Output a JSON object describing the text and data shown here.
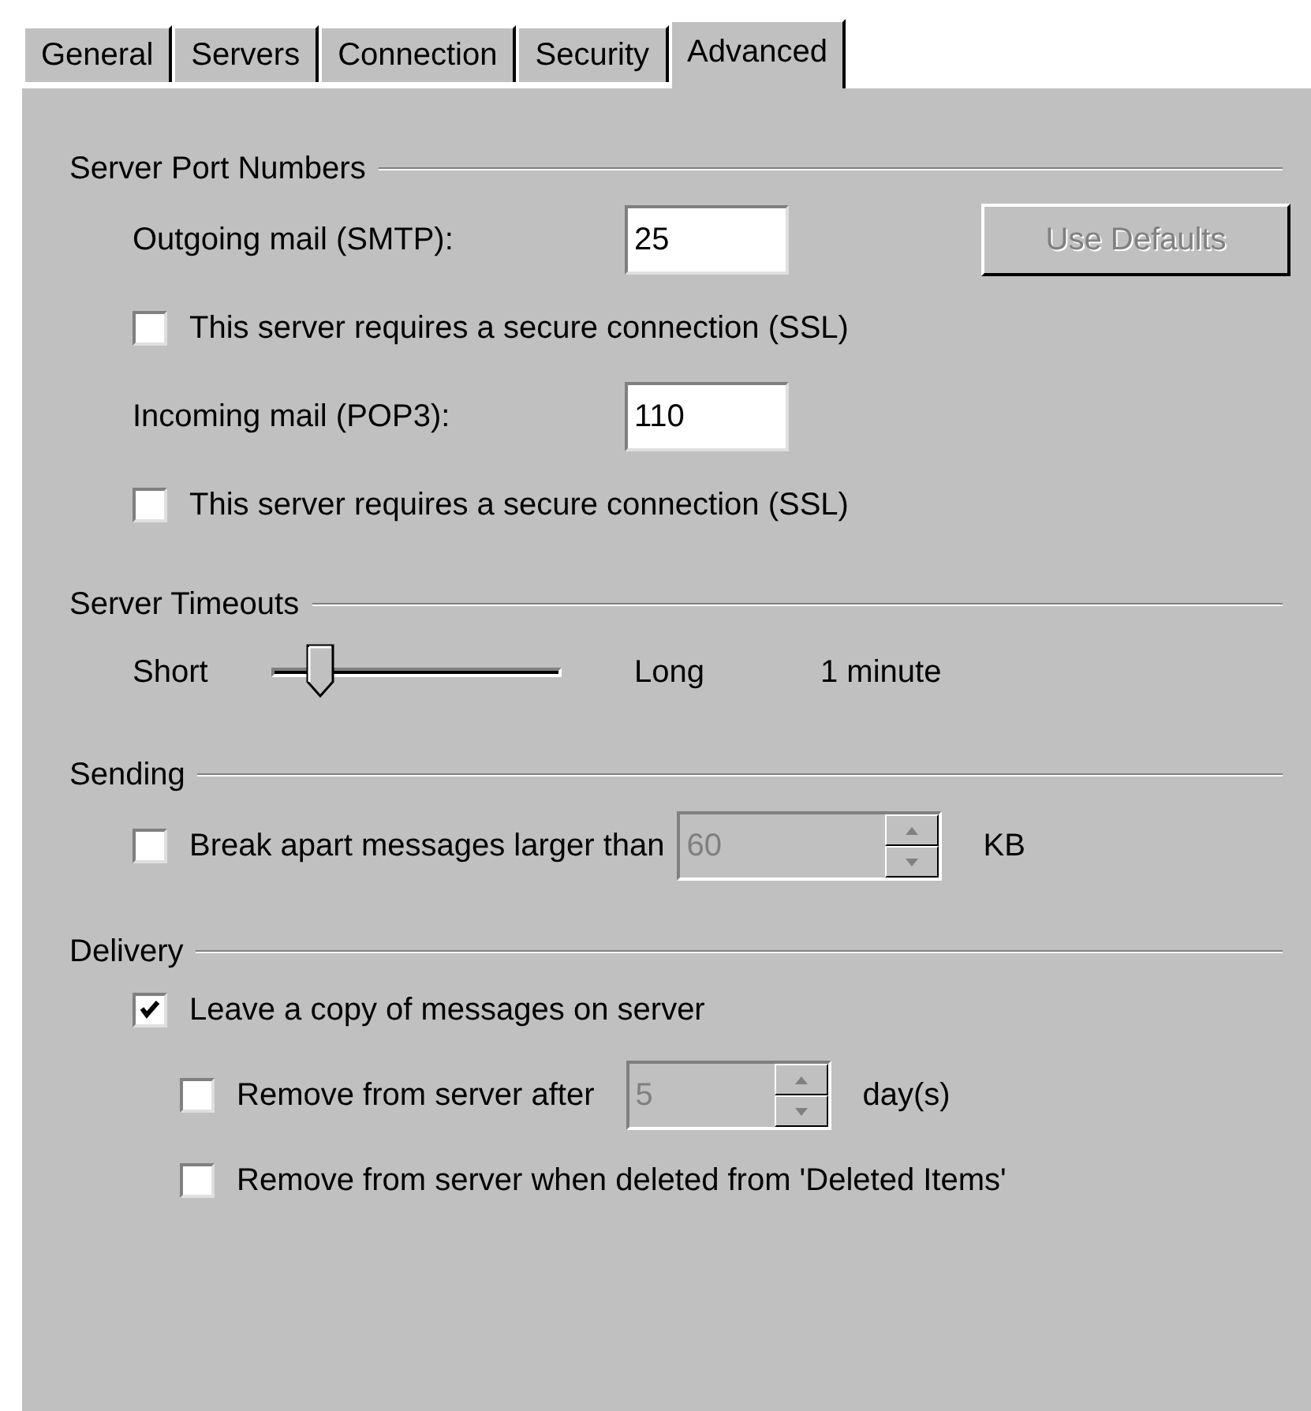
{
  "tabs": [
    {
      "label": "General",
      "selected": false
    },
    {
      "label": "Servers",
      "selected": false
    },
    {
      "label": "Connection",
      "selected": false
    },
    {
      "label": "Security",
      "selected": false
    },
    {
      "label": "Advanced",
      "selected": true
    }
  ],
  "port_numbers": {
    "title": "Server Port Numbers",
    "outgoing": {
      "label": "Outgoing mail (SMTP):",
      "value": "25",
      "ssl": {
        "label": "This server requires a secure connection (SSL)",
        "checked": false
      }
    },
    "use_defaults": {
      "label": "Use Defaults",
      "disabled": true
    },
    "incoming": {
      "label": "Incoming mail (POP3):",
      "value": "110",
      "ssl": {
        "label": "This server requires a secure connection (SSL)",
        "checked": false
      }
    }
  },
  "timeouts": {
    "title": "Server Timeouts",
    "min_label": "Short",
    "max_label": "Long",
    "level": 0.13,
    "reading": "1 minute"
  },
  "sending": {
    "title": "Sending",
    "break_apart": {
      "label": "Break apart messages larger than",
      "checked": false,
      "value": "60",
      "disabled": true,
      "unit": "KB"
    }
  },
  "delivery": {
    "title": "Delivery",
    "leave_copy": {
      "label": "Leave a copy of messages on server",
      "checked": true
    },
    "remove_after": {
      "label": "Remove from server after",
      "checked": false,
      "value": "5",
      "disabled": true,
      "unit": "day(s)"
    },
    "remove_deleted": {
      "label": "Remove from server when deleted from 'Deleted Items'",
      "checked": false
    }
  }
}
